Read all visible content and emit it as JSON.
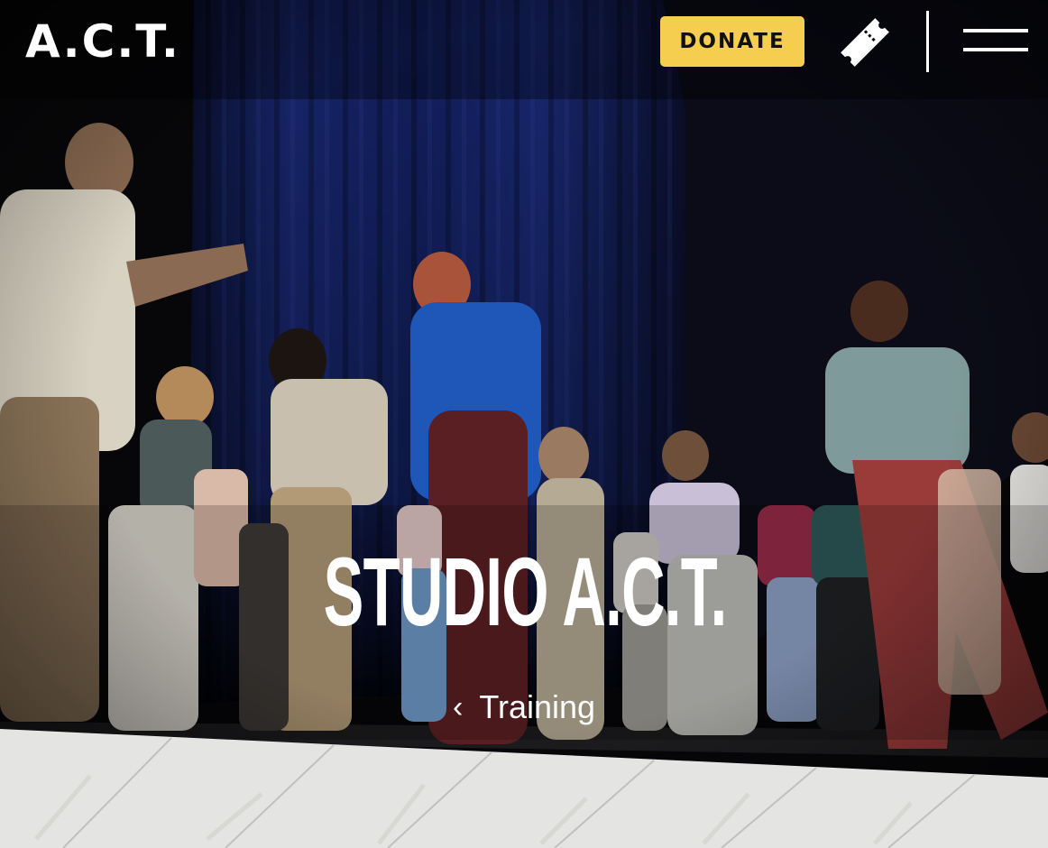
{
  "header": {
    "logo_text": "A.C.T.",
    "donate_label": "DONATE",
    "ticket_icon": "ticket-icon",
    "menu_icon": "hamburger-menu-icon"
  },
  "hero": {
    "title": "STUDIO A.C.T.",
    "breadcrumb_label": "Training",
    "breadcrumb_icon": "chevron-left-icon",
    "photo_description_icon": "hero-photo"
  },
  "colors": {
    "accent": "#f5cd4f",
    "text": "#ffffff",
    "curtain": "#14215e",
    "background": "#0a0a0c",
    "floor": "#e6e6e6"
  }
}
